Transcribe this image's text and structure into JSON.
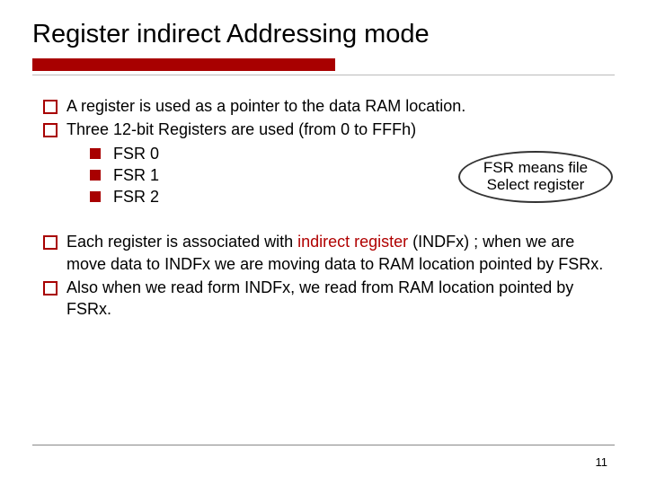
{
  "title": "Register indirect Addressing mode",
  "bullets": {
    "b1": "A register is used as a pointer to the data RAM location.",
    "b2": "Three 12-bit Registers are used (from 0 to FFFh)",
    "sub": {
      "s1": "FSR 0",
      "s2": "FSR 1",
      "s3": "FSR 2"
    },
    "b3_pre": "Each register is associated with ",
    "b3_red": "indirect register",
    "b3_post": "  (INDFx) ; when we are move data to INDFx we are moving data to RAM location pointed by FSRx.",
    "b4": "Also when we read form INDFx, we read from RAM location pointed by FSRx."
  },
  "oval": {
    "line1": "FSR means file",
    "line2": "Select register"
  },
  "page": "11"
}
